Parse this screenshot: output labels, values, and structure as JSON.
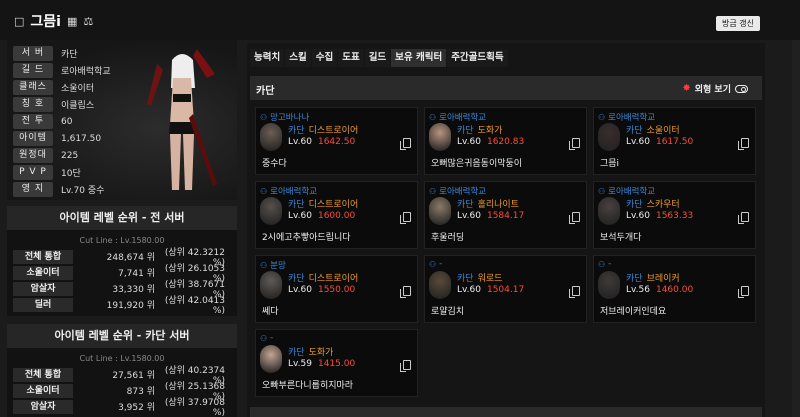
{
  "header": {
    "title": "그믐i",
    "refresh_label": "방금 갱신"
  },
  "profile": {
    "rows": [
      {
        "label": "서 버",
        "value": "카단"
      },
      {
        "label": "길 드",
        "value": "로아배럭학교"
      },
      {
        "label": "클래스",
        "value": "소울이터"
      },
      {
        "label": "칭 호",
        "value": "이클립스"
      },
      {
        "label": "전 투",
        "value": "60"
      },
      {
        "label": "아이템",
        "value": "1,617.50"
      },
      {
        "label": "원정대",
        "value": "225"
      },
      {
        "label": "P V P",
        "value": "10단"
      },
      {
        "label": "영 지",
        "value": "Lv.70 중수"
      }
    ]
  },
  "rank_total": {
    "title": "아이템 레벨 순위 - 전 서버",
    "cutline": "Cut Line : Lv.1580.00",
    "rows": [
      {
        "label": "전체 통합",
        "rank": "248,674 위",
        "pct": "(상위 42.3212 %)"
      },
      {
        "label": "소울이터",
        "rank": "7,741 위",
        "pct": "(상위 26.1053 %)"
      },
      {
        "label": "암살자",
        "rank": "33,330 위",
        "pct": "(상위 38.7671 %)"
      },
      {
        "label": "딜러",
        "rank": "191,920 위",
        "pct": "(상위 42.0413 %)"
      }
    ]
  },
  "rank_server": {
    "title": "아이템 레벨 순위 - 카단 서버",
    "cutline": "Cut Line : Lv.1580.00",
    "rows": [
      {
        "label": "전체 통합",
        "rank": "27,561 위",
        "pct": "(상위 40.2374 %)"
      },
      {
        "label": "소울이터",
        "rank": "873 위",
        "pct": "(상위 25.1368 %)"
      },
      {
        "label": "암살자",
        "rank": "3,952 위",
        "pct": "(상위 37.9708 %)"
      }
    ]
  },
  "tabs": [
    "능력치",
    "스킬",
    "수집",
    "도표",
    "길드",
    "보유 캐릭터",
    "주간골드획득"
  ],
  "server_bar": {
    "name": "카단",
    "appearance_label": "외형 보기"
  },
  "cards": [
    {
      "guild": "망고바나나",
      "server": "카단",
      "class": "디스트로이어",
      "level": "Lv.60",
      "ilvl": "1642.50",
      "name": "중수다"
    },
    {
      "guild": "로아배럭학교",
      "server": "카단",
      "class": "도화가",
      "level": "Lv.60",
      "ilvl": "1620.83",
      "name": "오뻐많은귀음동이막둥이"
    },
    {
      "guild": "로아배럭학교",
      "server": "카단",
      "class": "소울이터",
      "level": "Lv.60",
      "ilvl": "1617.50",
      "name": "그믐i"
    },
    {
      "guild": "로아배럭학교",
      "server": "카단",
      "class": "디스트로이어",
      "level": "Lv.60",
      "ilvl": "1600.00",
      "name": "2시에고추빻아드립니다"
    },
    {
      "guild": "로아배럭학교",
      "server": "카단",
      "class": "홀리나이트",
      "level": "Lv.60",
      "ilvl": "1584.17",
      "name": "후울러딩"
    },
    {
      "guild": "로아배럭학교",
      "server": "카단",
      "class": "스카우터",
      "level": "Lv.60",
      "ilvl": "1563.33",
      "name": "보석두개다"
    },
    {
      "guild": "분망",
      "server": "카단",
      "class": "디스트로이어",
      "level": "Lv.60",
      "ilvl": "1550.00",
      "name": "쎄다"
    },
    {
      "guild": "-",
      "server": "카단",
      "class": "워로드",
      "level": "Lv.60",
      "ilvl": "1504.17",
      "name": "로얄김치"
    },
    {
      "guild": "-",
      "server": "카단",
      "class": "브레이커",
      "level": "Lv.56",
      "ilvl": "1460.00",
      "name": "저브레이커인데요"
    },
    {
      "guild": "-",
      "server": "카단",
      "class": "도화가",
      "level": "Lv.59",
      "ilvl": "1415.00",
      "name": "오빠부른다니롭히지마라"
    }
  ],
  "colors": {
    "guild": "#3d86d6",
    "class": "#f09a2a",
    "ilvl": "#ff4a3a"
  }
}
